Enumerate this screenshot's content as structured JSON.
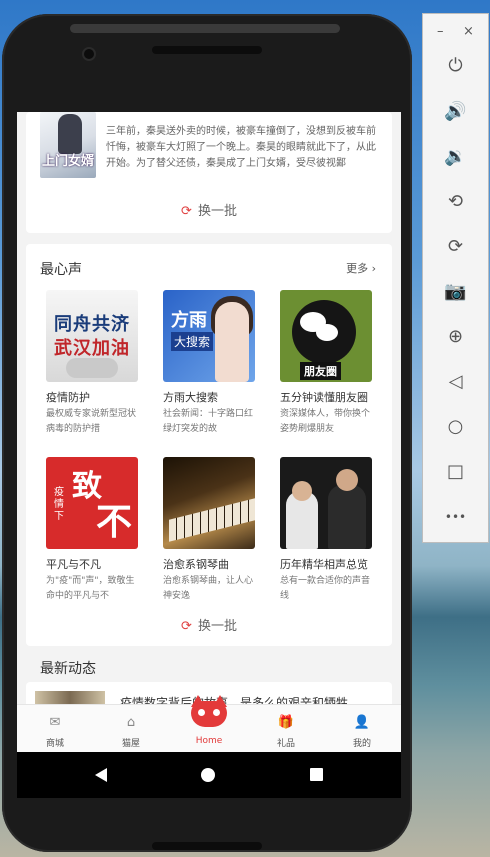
{
  "emulator": {
    "minimize": "–",
    "close": "×",
    "buttons": [
      {
        "name": "power-icon",
        "glyph": "⏻"
      },
      {
        "name": "volume-up-icon",
        "glyph": "🔊"
      },
      {
        "name": "volume-down-icon",
        "glyph": "🔉"
      },
      {
        "name": "rotate-left-icon",
        "glyph": "⟲"
      },
      {
        "name": "rotate-right-icon",
        "glyph": "⟳"
      },
      {
        "name": "camera-icon",
        "glyph": "📷"
      },
      {
        "name": "zoom-icon",
        "glyph": "⊕"
      },
      {
        "name": "back-icon",
        "glyph": "◁"
      },
      {
        "name": "home-icon",
        "glyph": "○"
      },
      {
        "name": "overview-icon",
        "glyph": "□"
      },
      {
        "name": "more-icon",
        "glyph": "•••"
      }
    ]
  },
  "top_card": {
    "cover_title": "上门女婿",
    "cover_sub": "",
    "description": "三年前，秦昊送外卖的时候，被豪车撞倒了，没想到反被车前忏悔，被豪车大灯照了一个晚上。秦昊的眼睛就此下了，从此开始。为了替父还债，秦昊成了上门女婿，受尽彼视鄙",
    "refresh_label": "换一批"
  },
  "section_heart": {
    "title": "最心声",
    "more_label": "更多",
    "items": [
      {
        "name": "疫情防护",
        "desc": "最权威专家说新型冠状病毒的防护措",
        "cover_l1": "同舟共济",
        "cover_l2": "武汉加油"
      },
      {
        "name": "方雨大搜索",
        "desc": "社会新闻：十字路口红绿灯突发的故",
        "cover_l1": "方雨",
        "cover_l2": "大搜索"
      },
      {
        "name": "五分钟读懂朋友圈",
        "desc": "资深媒体人，带你换个姿势刷爆朋友",
        "cover_l1": "朋友圈"
      },
      {
        "name": "平凡与不凡",
        "desc": "为\"疫\"而\"声\"，致敬生命中的平凡与不",
        "cover_l1": "致",
        "cover_l2": "不凡",
        "cover_sm": "疫情下"
      },
      {
        "name": "治愈系钢琴曲",
        "desc": "治愈系钢琴曲，让人心神安逸"
      },
      {
        "name": "历年精华相声总览",
        "desc": "总有一款合适你的声音线"
      }
    ],
    "refresh_label": "换一批"
  },
  "section_news": {
    "title": "最新动态",
    "headline": "疫情数字背后的故事，是多么的艰辛和牺牲"
  },
  "tabbar": {
    "tabs": [
      {
        "label": "商城",
        "icon": "✉"
      },
      {
        "label": "猫屋",
        "icon": "⌂"
      },
      {
        "label": "Home",
        "icon": ""
      },
      {
        "label": "礼品",
        "icon": "🎁"
      },
      {
        "label": "我的",
        "icon": "👤"
      }
    ]
  }
}
